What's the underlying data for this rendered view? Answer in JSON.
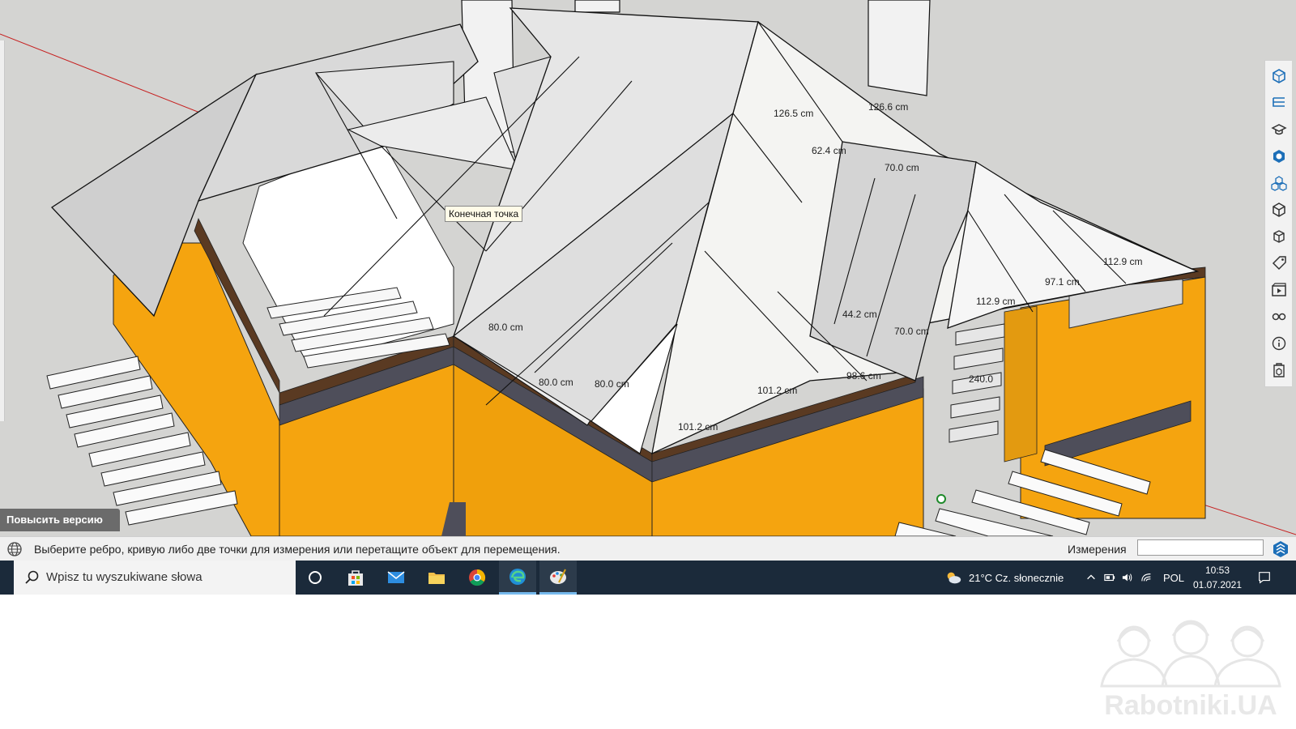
{
  "viewport": {
    "tooltip": "Конечная точка",
    "upgrade_button": "Повысить версию",
    "dimensions": [
      "126.5 cm",
      "126.6 cm",
      "62.4 cm",
      "70.0 cm",
      "112.9 cm",
      "97.1 cm",
      "112.9 cm",
      "44.2 cm",
      "70.0 cm",
      "80.0 cm",
      "80.0 cm",
      "80.0 cm",
      "101.2 cm",
      "98.6 cm",
      "101.2 cm",
      "240.0"
    ],
    "colors": {
      "wall": "#f5a40f",
      "roof": "#f4f4f2",
      "sky": "#d4d4d2",
      "fascia": "#5a3a22",
      "band": "#4e4e5a"
    }
  },
  "right_toolbar": {
    "icons": [
      "entity-info-icon",
      "outliner-icon",
      "instructor-icon",
      "materials-icon",
      "components-icon",
      "styles-icon",
      "layers-icon",
      "tags-icon",
      "scenes-icon",
      "shadows-icon",
      "info-icon",
      "warehouse-icon"
    ]
  },
  "statusbar": {
    "message": "Выберите ребро, кривую либо две точки для измерения или перетащите объект для перемещения.",
    "measurements_label": "Измерения",
    "measurements_value": ""
  },
  "taskbar": {
    "search_placeholder": "Wpisz tu wyszukiwane słowa",
    "apps": [
      "cortana-icon",
      "store-icon",
      "mail-icon",
      "file-explorer-icon",
      "chrome-icon",
      "edge-icon",
      "paint-icon"
    ],
    "weather": "21°C  Cz. słonecznie",
    "language": "POL",
    "time": "10:53",
    "date": "01.07.2021"
  },
  "watermark": "Rabotniki.UA"
}
